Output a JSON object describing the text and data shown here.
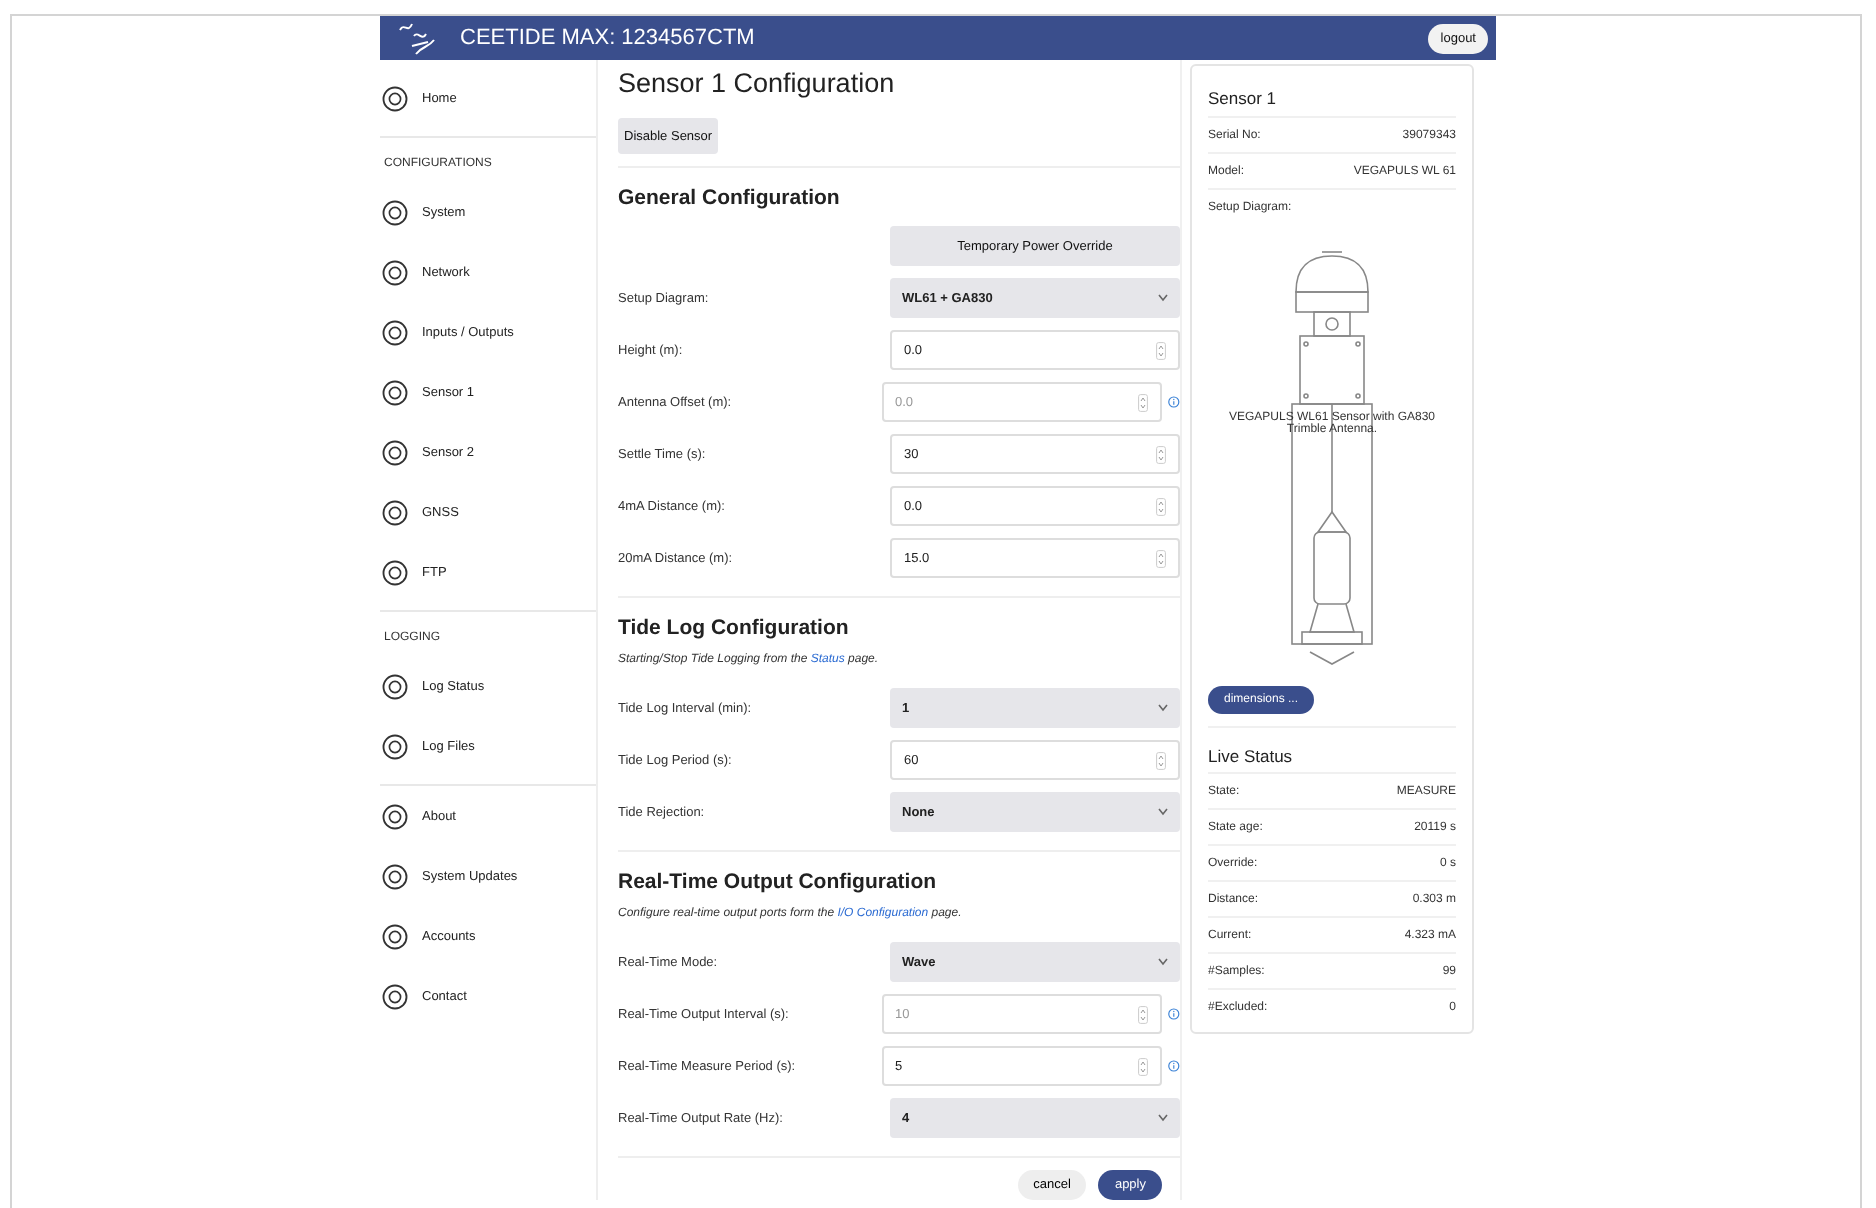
{
  "header": {
    "title": "CEETIDE MAX: 1234567CTM",
    "logout": "logout"
  },
  "sidebar": {
    "sections": [
      {
        "items": [
          {
            "label": "Home"
          }
        ]
      },
      {
        "heading": "CONFIGURATIONS",
        "items": [
          {
            "label": "System"
          },
          {
            "label": "Network"
          },
          {
            "label": "Inputs / Outputs"
          },
          {
            "label": "Sensor 1"
          },
          {
            "label": "Sensor 2"
          },
          {
            "label": "GNSS"
          },
          {
            "label": "FTP"
          }
        ]
      },
      {
        "heading": "LOGGING",
        "items": [
          {
            "label": "Log Status"
          },
          {
            "label": "Log Files"
          }
        ]
      },
      {
        "items": [
          {
            "label": "About"
          },
          {
            "label": "System Updates"
          },
          {
            "label": "Accounts"
          },
          {
            "label": "Contact"
          }
        ]
      }
    ]
  },
  "main": {
    "title": "Sensor 1 Configuration",
    "disable_button": "Disable Sensor",
    "sections": [
      {
        "title": "General Configuration",
        "fields": [
          {
            "kind": "button",
            "label": "Temporary Power Override"
          },
          {
            "kind": "select",
            "label": "Setup Diagram:",
            "value": "WL61 + GA830",
            "disabled": false,
            "info": false
          },
          {
            "kind": "number",
            "label": "Height (m):",
            "value": "0.0",
            "disabled": false,
            "info": false
          },
          {
            "kind": "number",
            "label": "Antenna Offset (m):",
            "value": "0.0",
            "disabled": true,
            "info": true
          },
          {
            "kind": "number",
            "label": "Settle Time (s):",
            "value": "30",
            "disabled": false,
            "info": false
          },
          {
            "kind": "number",
            "label": "4mA Distance (m):",
            "value": "0.0",
            "disabled": false,
            "info": false
          },
          {
            "kind": "number",
            "label": "20mA Distance (m):",
            "value": "15.0",
            "disabled": false,
            "info": false
          }
        ]
      },
      {
        "title": "Tide Log Configuration",
        "note": {
          "before": "Starting/Stop Tide Logging from the ",
          "link": "Status",
          "after": " page."
        },
        "fields": [
          {
            "kind": "select",
            "label": "Tide Log Interval (min):",
            "value": "1",
            "disabled": false,
            "info": false
          },
          {
            "kind": "number",
            "label": "Tide Log Period (s):",
            "value": "60",
            "disabled": false,
            "info": false
          },
          {
            "kind": "select",
            "label": "Tide Rejection:",
            "value": "None",
            "disabled": false,
            "info": false
          }
        ]
      },
      {
        "title": "Real-Time Output Configuration",
        "note": {
          "before": "Configure real-time output ports form the ",
          "link": "I/O Configuration",
          "after": " page."
        },
        "fields": [
          {
            "kind": "select",
            "label": "Real-Time Mode:",
            "value": "Wave",
            "disabled": false,
            "info": false
          },
          {
            "kind": "number",
            "label": "Real-Time Output Interval (s):",
            "value": "10",
            "disabled": true,
            "info": true
          },
          {
            "kind": "number",
            "label": "Real-Time Measure Period (s):",
            "value": "5",
            "disabled": false,
            "info": true
          },
          {
            "kind": "select",
            "label": "Real-Time Output Rate (Hz):",
            "value": "4",
            "disabled": false,
            "info": false
          }
        ]
      }
    ],
    "cancel": "cancel",
    "apply": "apply"
  },
  "panel": {
    "title": "Sensor 1",
    "info": [
      {
        "label": "Serial No:",
        "value": "39079343"
      },
      {
        "label": "Model:",
        "value": "VEGAPULS WL 61"
      }
    ],
    "diagram_label": "Setup Diagram:",
    "diagram_caption": "VEGAPULS WL61 Sensor with GA830 Trimble Antenna.",
    "dimensions_button": "dimensions ...",
    "live_title": "Live Status",
    "live": [
      {
        "label": "State:",
        "value": "MEASURE"
      },
      {
        "label": "State age:",
        "value": "20119 s"
      },
      {
        "label": "Override:",
        "value": "0 s"
      },
      {
        "label": "Distance:",
        "value": "0.303 m"
      },
      {
        "label": "Current:",
        "value": "4.323 mA"
      },
      {
        "label": "#Samples:",
        "value": "99"
      },
      {
        "label": "#Excluded:",
        "value": "0"
      }
    ]
  }
}
